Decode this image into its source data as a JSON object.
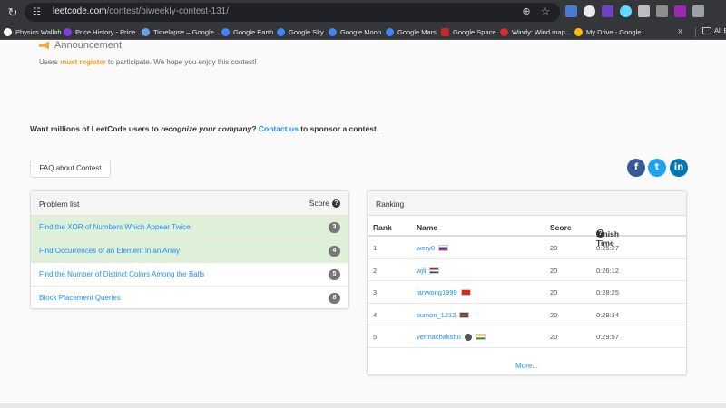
{
  "browser": {
    "url_host": "leetcode.com",
    "url_path": "/contest/biweekly-contest-131/",
    "bookmarks": [
      {
        "label": "Physics Wallah",
        "color": "#ffffff"
      },
      {
        "label": "Price History - Price...",
        "color": "#7b3fe4"
      },
      {
        "label": "Timelapse – Google...",
        "color": "#6aa0e8"
      },
      {
        "label": "Google Earth",
        "color": "#4285f4"
      },
      {
        "label": "Google Sky",
        "color": "#4285f4"
      },
      {
        "label": "Google Moon",
        "color": "#4285f4"
      },
      {
        "label": "Google Mars",
        "color": "#4285f4"
      },
      {
        "label": "Google Space",
        "color": "#c62828"
      },
      {
        "label": "Windy: Wind map...",
        "color": "#d32f2f"
      },
      {
        "label": "My Drive - Google...",
        "color": "#fbbc04"
      }
    ],
    "all_bookmarks_label": "All B"
  },
  "announcement": {
    "title": "Announcement",
    "text_before": "Users ",
    "link_text": "must register",
    "text_after": " to participate. We hope you enjoy this contest!"
  },
  "sponsor": {
    "part1": "Want millions of LeetCode users to ",
    "emphasis": "recognize your company",
    "part2": "? ",
    "link": "Contact us",
    "part3": " to sponsor a contest."
  },
  "faq_label": "FAQ about Contest",
  "social": {
    "facebook": "f",
    "twitter": "t",
    "linkedin": "in"
  },
  "problems": {
    "title": "Problem list",
    "score_header": "Score",
    "items": [
      {
        "name": "Find the XOR of Numbers Which Appear Twice",
        "score": "3",
        "solved": true
      },
      {
        "name": "Find Occurrences of an Element in an Array",
        "score": "4",
        "solved": true
      },
      {
        "name": "Find the Number of Distinct Colors Among the Balls",
        "score": "5",
        "solved": false
      },
      {
        "name": "Block Placement Queries",
        "score": "8",
        "solved": false
      }
    ]
  },
  "ranking": {
    "title": "Ranking",
    "headers": {
      "rank": "Rank",
      "name": "Name",
      "score": "Score",
      "finish": "Finish Time"
    },
    "rows": [
      {
        "rank": "1",
        "name": "wery0",
        "score": "20",
        "time": "0:25:27",
        "flag": [
          "#ffffff",
          "#1c57c9",
          "#e1261c"
        ]
      },
      {
        "rank": "2",
        "name": "wjli",
        "score": "20",
        "time": "0:26:12",
        "flag": [
          "#b22234",
          "#ffffff",
          "#3c3b6e"
        ]
      },
      {
        "rank": "3",
        "name": "ianwong1999",
        "score": "20",
        "time": "0:28:25",
        "flag": [
          "#de2910",
          "#de2910",
          "#de2910"
        ]
      },
      {
        "rank": "4",
        "name": "sumon_1212",
        "score": "20",
        "time": "0:29:34",
        "flag": [
          "#006a4e",
          "#f42a41",
          "#006a4e"
        ]
      },
      {
        "rank": "5",
        "name": "vermachakshu",
        "score": "20",
        "time": "0:29:57",
        "flag": [
          "#ff9933",
          "#ffffff",
          "#138808"
        ]
      }
    ],
    "more": "More..."
  }
}
